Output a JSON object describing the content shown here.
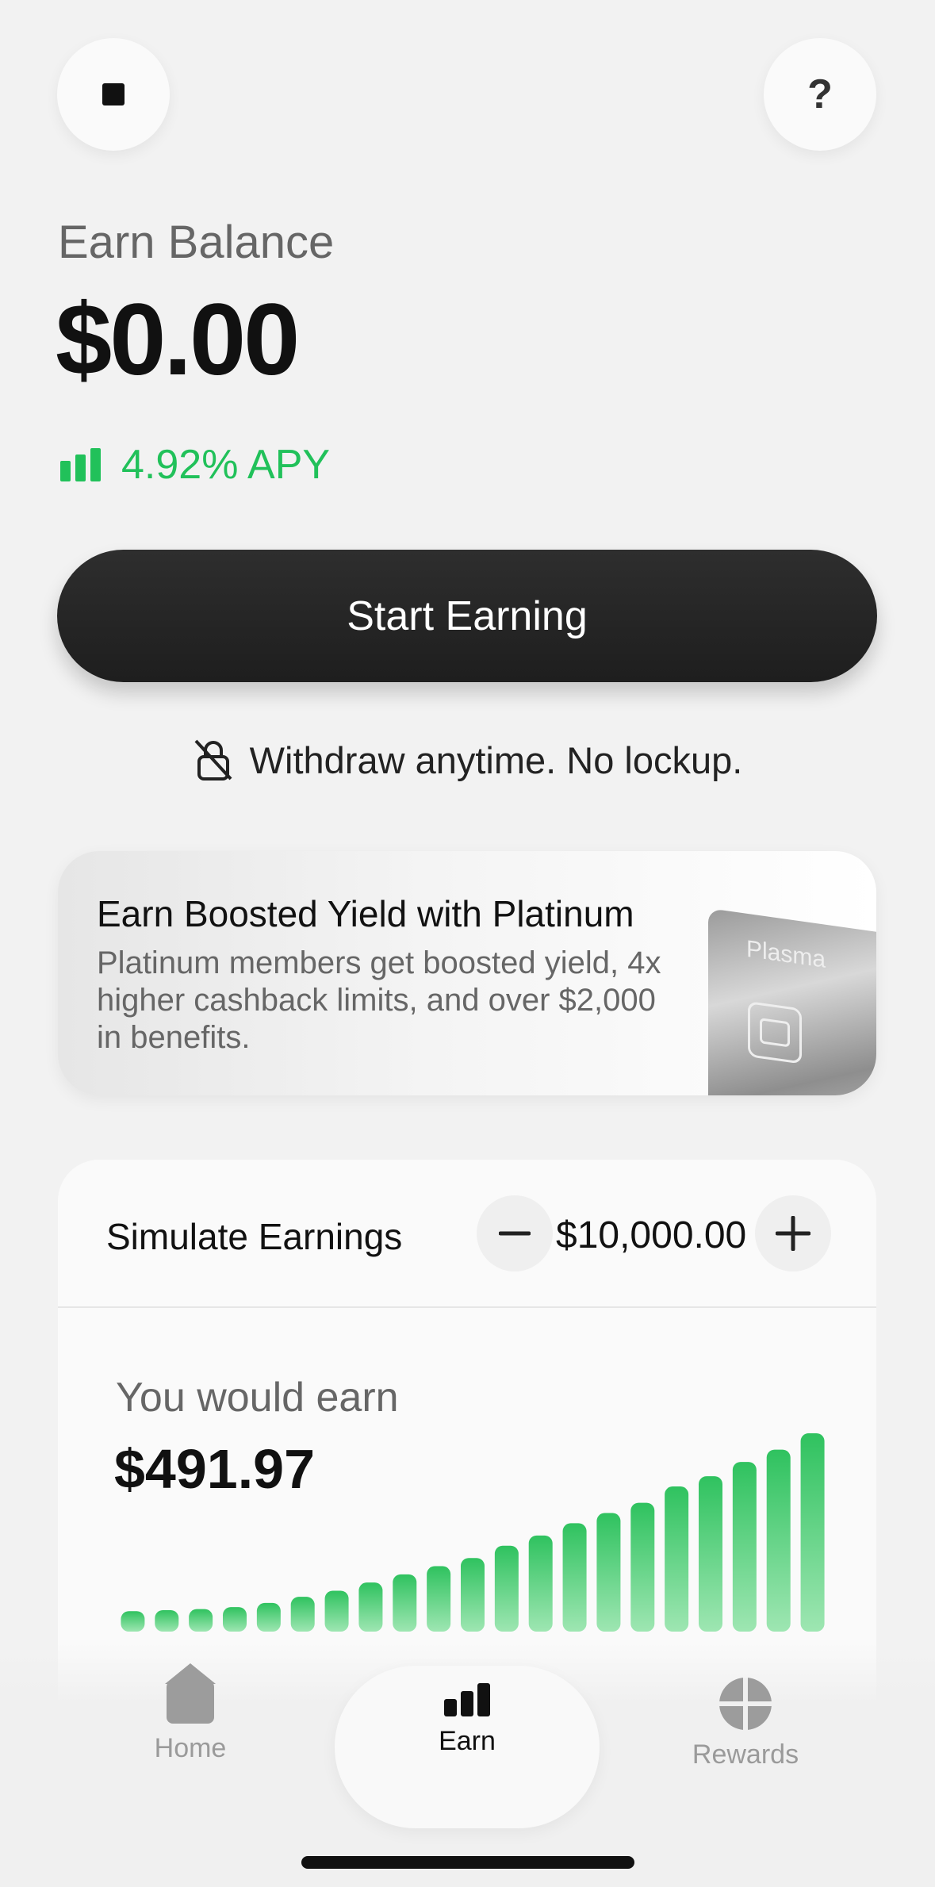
{
  "header": {
    "left_icon": "stop-icon",
    "right_icon": "help-icon",
    "right_label": "?"
  },
  "balance": {
    "title": "Earn Balance",
    "amount": "$0.00",
    "apy_icon": "bars-icon",
    "apy": "4.92% APY"
  },
  "cta": {
    "label": "Start Earning"
  },
  "withdraw": {
    "icon": "lock-off-icon",
    "text": "Withdraw anytime. No lockup."
  },
  "promo": {
    "title": "Earn Boosted Yield with Platinum",
    "body": "Platinum members get boosted yield, 4x higher cashback limits, and over $2,000 in benefits.",
    "card_brand": "Plasma"
  },
  "simulate": {
    "title": "Simulate Earnings",
    "amount": "$10,000.00",
    "minus_icon": "minus-icon",
    "plus_icon": "plus-icon",
    "earn_label": "You would earn",
    "earn_value": "$491.97"
  },
  "chart_data": {
    "type": "bar",
    "values": [
      1,
      1.05,
      1.1,
      1.2,
      1.4,
      1.7,
      2.0,
      2.4,
      2.8,
      3.2,
      3.6,
      4.2,
      4.7,
      5.3,
      5.8,
      6.3,
      7.1,
      7.6,
      8.3,
      8.9,
      9.7
    ]
  },
  "tabs": [
    {
      "label": "Home",
      "icon": "home-icon",
      "active": false
    },
    {
      "label": "Earn",
      "icon": "earn-icon",
      "active": true
    },
    {
      "label": "Rewards",
      "icon": "rewards-icon",
      "active": false
    }
  ],
  "colors": {
    "accent_green": "#21c15a",
    "dark_button": "#242424",
    "muted_text": "#666666"
  }
}
